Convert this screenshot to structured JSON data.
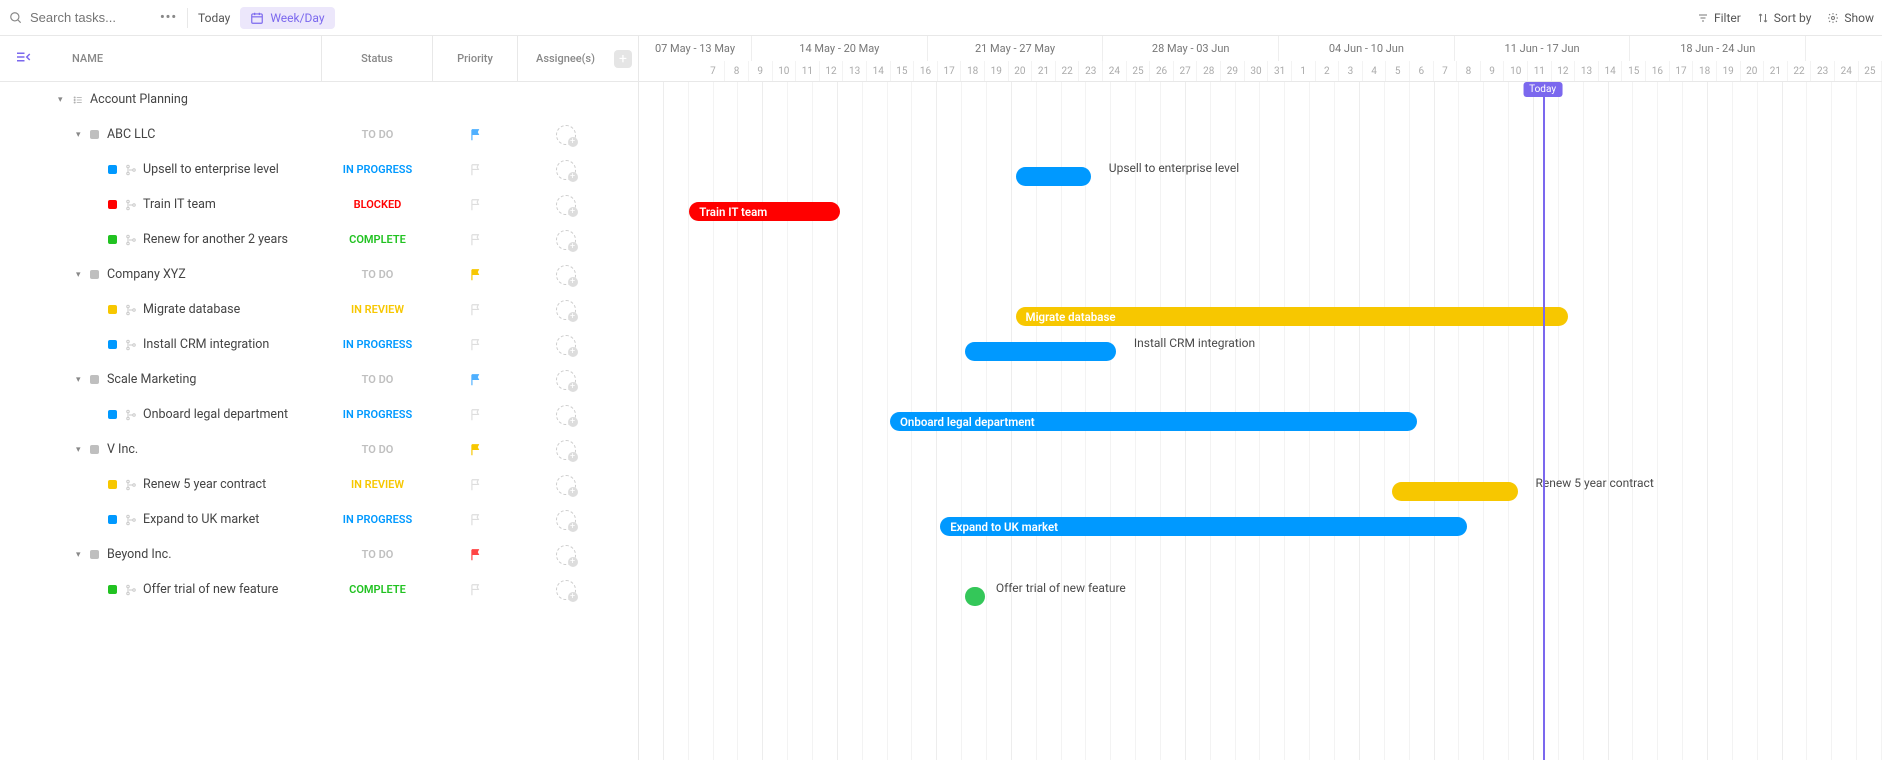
{
  "toolbar": {
    "search_placeholder": "Search tasks...",
    "today": "Today",
    "view": "Week/Day",
    "filter": "Filter",
    "sortby": "Sort by",
    "show": "Show"
  },
  "columns": {
    "name": "NAME",
    "status": "Status",
    "priority": "Priority",
    "assignee": "Assignee(s)"
  },
  "timeline": {
    "weeks": [
      "07 May - 13 May",
      "14 May - 20 May",
      "21 May - 27 May",
      "28 May - 03 Jun",
      "04 Jun - 10 Jun",
      "11 Jun - 17 Jun",
      "18 Jun - 24 Jun"
    ],
    "days": [
      "7",
      "8",
      "9",
      "10",
      "11",
      "12",
      "13",
      "14",
      "15",
      "16",
      "17",
      "18",
      "19",
      "20",
      "21",
      "22",
      "23",
      "24",
      "25",
      "26",
      "27",
      "28",
      "29",
      "30",
      "31",
      "1",
      "2",
      "3",
      "4",
      "5",
      "6",
      "7",
      "8",
      "9",
      "10",
      "11",
      "12",
      "13",
      "14",
      "15",
      "16",
      "17",
      "18",
      "19",
      "20",
      "21",
      "22",
      "23",
      "24",
      "25"
    ],
    "today_label": "Today",
    "today_index": 36
  },
  "rows": [
    {
      "type": "group",
      "indent": 0,
      "name": "Account Planning",
      "caret": true,
      "listicon": true
    },
    {
      "type": "group",
      "indent": 1,
      "name": "ABC LLC",
      "status": "TO DO",
      "status_cls": "TODO",
      "sq": "grey",
      "flag_color": "#4fb0ff",
      "flag_on": true,
      "caret": true
    },
    {
      "type": "task",
      "indent": 2,
      "name": "Upsell to enterprise level",
      "status": "IN PROGRESS",
      "status_cls": "INPROGRESS",
      "sq": "blue",
      "flag_color": "#ddd",
      "flag_on": false
    },
    {
      "type": "task",
      "indent": 2,
      "name": "Train IT team",
      "status": "BLOCKED",
      "status_cls": "BLOCKED",
      "sq": "red",
      "flag_color": "#ddd",
      "flag_on": false
    },
    {
      "type": "task",
      "indent": 2,
      "name": "Renew for another 2 years",
      "status": "COMPLETE",
      "status_cls": "COMPLETE",
      "sq": "green",
      "flag_color": "#ddd",
      "flag_on": false
    },
    {
      "type": "group",
      "indent": 1,
      "name": "Company XYZ",
      "status": "TO DO",
      "status_cls": "TODO",
      "sq": "grey",
      "flag_color": "#f7c700",
      "flag_on": true,
      "caret": true
    },
    {
      "type": "task",
      "indent": 2,
      "name": "Migrate database",
      "status": "IN REVIEW",
      "status_cls": "INREVIEW",
      "sq": "yellow",
      "flag_color": "#ddd",
      "flag_on": false
    },
    {
      "type": "task",
      "indent": 2,
      "name": "Install CRM integration",
      "status": "IN PROGRESS",
      "status_cls": "INPROGRESS",
      "sq": "blue",
      "flag_color": "#ddd",
      "flag_on": false
    },
    {
      "type": "group",
      "indent": 1,
      "name": "Scale Marketing",
      "status": "TO DO",
      "status_cls": "TODO",
      "sq": "grey",
      "flag_color": "#4fb0ff",
      "flag_on": true,
      "caret": true
    },
    {
      "type": "task",
      "indent": 2,
      "name": "Onboard legal department",
      "status": "IN PROGRESS",
      "status_cls": "INPROGRESS",
      "sq": "blue",
      "flag_color": "#ddd",
      "flag_on": false
    },
    {
      "type": "group",
      "indent": 1,
      "name": "V Inc.",
      "status": "TO DO",
      "status_cls": "TODO",
      "sq": "grey",
      "flag_color": "#f7c700",
      "flag_on": true,
      "caret": true
    },
    {
      "type": "task",
      "indent": 2,
      "name": "Renew 5 year contract",
      "status": "IN REVIEW",
      "status_cls": "INREVIEW",
      "sq": "yellow",
      "flag_color": "#ddd",
      "flag_on": false
    },
    {
      "type": "task",
      "indent": 2,
      "name": "Expand to UK market",
      "status": "IN PROGRESS",
      "status_cls": "INPROGRESS",
      "sq": "blue",
      "flag_color": "#ddd",
      "flag_on": false
    },
    {
      "type": "group",
      "indent": 1,
      "name": "Beyond Inc.",
      "status": "TO DO",
      "status_cls": "TODO",
      "sq": "grey",
      "flag_color": "#f44",
      "flag_on": true,
      "caret": true
    },
    {
      "type": "task",
      "indent": 2,
      "name": "Offer trial of new feature",
      "status": "COMPLETE",
      "status_cls": "COMPLETE",
      "sq": "green",
      "flag_color": "#ddd",
      "flag_on": false
    }
  ],
  "bars": [
    {
      "row": 2,
      "start": 15,
      "span": 3,
      "color": "blue",
      "label_out": "Upsell to enterprise level"
    },
    {
      "row": 3,
      "start": 2,
      "span": 6,
      "color": "red",
      "label_in": "Train IT team"
    },
    {
      "row": 6,
      "start": 15,
      "span": 22,
      "color": "yellow",
      "label_in": "Migrate database"
    },
    {
      "row": 7,
      "start": 13,
      "span": 6,
      "color": "blue",
      "label_out": "Install CRM integration"
    },
    {
      "row": 9,
      "start": 10,
      "span": 21,
      "color": "blue",
      "label_in": "Onboard legal department"
    },
    {
      "row": 11,
      "start": 30,
      "span": 5,
      "color": "yellow",
      "label_out": "Renew 5 year contract"
    },
    {
      "row": 12,
      "start": 12,
      "span": 21,
      "color": "blue",
      "label_in": "Expand to UK market"
    },
    {
      "row": 14,
      "start": 13,
      "span": 0.5,
      "color": "green",
      "label_out": "Offer trial of new feature"
    }
  ],
  "chart_data": {
    "type": "gantt",
    "x_unit": "day",
    "x_range_start": "2018-05-07",
    "x_range_end": "2018-06-25",
    "today": "2018-06-12",
    "tasks": [
      {
        "name": "Upsell to enterprise level",
        "start": "2018-05-22",
        "end": "2018-05-24",
        "status": "IN PROGRESS",
        "group": "ABC LLC"
      },
      {
        "name": "Train IT team",
        "start": "2018-05-09",
        "end": "2018-05-14",
        "status": "BLOCKED",
        "group": "ABC LLC"
      },
      {
        "name": "Renew for another 2 years",
        "start": null,
        "end": null,
        "status": "COMPLETE",
        "group": "ABC LLC"
      },
      {
        "name": "Migrate database",
        "start": "2018-05-22",
        "end": "2018-06-12",
        "status": "IN REVIEW",
        "group": "Company XYZ"
      },
      {
        "name": "Install CRM integration",
        "start": "2018-05-20",
        "end": "2018-05-25",
        "status": "IN PROGRESS",
        "group": "Company XYZ"
      },
      {
        "name": "Onboard legal department",
        "start": "2018-05-17",
        "end": "2018-06-06",
        "status": "IN PROGRESS",
        "group": "Scale Marketing"
      },
      {
        "name": "Renew 5 year contract",
        "start": "2018-06-06",
        "end": "2018-06-10",
        "status": "IN REVIEW",
        "group": "V Inc."
      },
      {
        "name": "Expand to UK market",
        "start": "2018-05-19",
        "end": "2018-06-08",
        "status": "IN PROGRESS",
        "group": "V Inc."
      },
      {
        "name": "Offer trial of new feature",
        "start": "2018-05-20",
        "end": "2018-05-20",
        "status": "COMPLETE",
        "group": "Beyond Inc."
      }
    ]
  }
}
